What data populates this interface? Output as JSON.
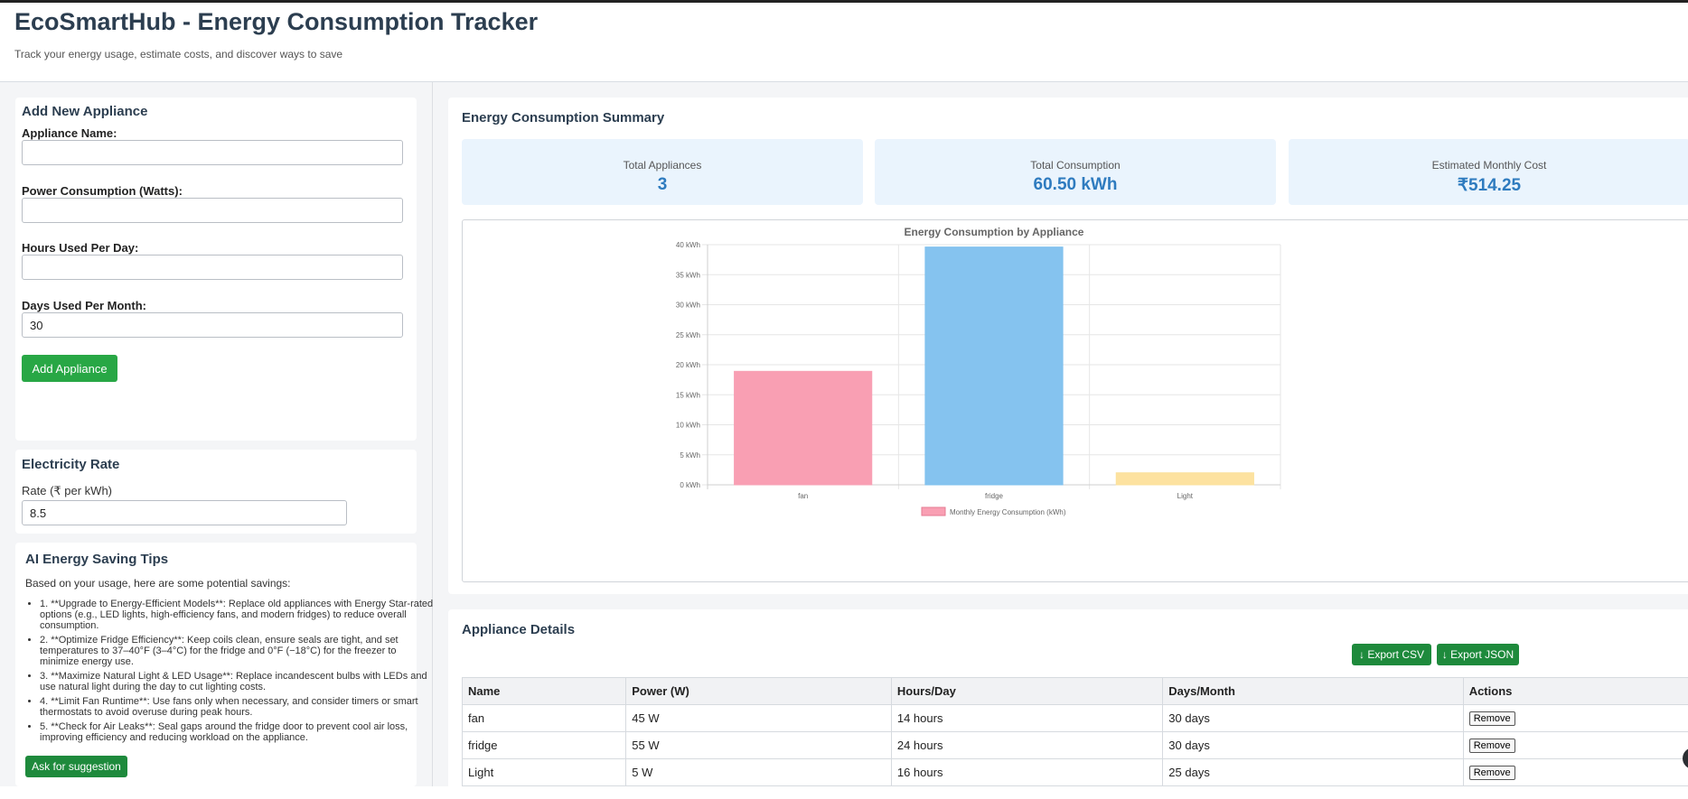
{
  "header": {
    "title": "EcoSmartHub - Energy Consumption Tracker",
    "subtitle": "Track your energy usage, estimate costs, and discover ways to save"
  },
  "add_appliance": {
    "heading": "Add New Appliance",
    "name_label": "Appliance Name:",
    "name_value": "",
    "power_label": "Power Consumption (Watts):",
    "power_value": "",
    "hours_label": "Hours Used Per Day:",
    "hours_value": "",
    "days_label": "Days Used Per Month:",
    "days_value": "30",
    "submit_label": "Add Appliance"
  },
  "electricity_rate": {
    "heading": "Electricity Rate",
    "rate_label": "Rate (₹ per kWh)",
    "rate_value": "8.5"
  },
  "tips": {
    "heading": "AI Energy Saving Tips",
    "intro": "Based on your usage, here are some potential savings:",
    "items": [
      "1. **Upgrade to Energy-Efficient Models**: Replace old appliances with Energy Star-rated options (e.g., LED lights, high-efficiency fans, and modern fridges) to reduce overall consumption.",
      "2. **Optimize Fridge Efficiency**: Keep coils clean, ensure seals are tight, and set temperatures to 37–40°F (3–4°C) for the fridge and 0°F (−18°C) for the freezer to minimize energy use.",
      "3. **Maximize Natural Light & LED Usage**: Replace incandescent bulbs with LEDs and use natural light during the day to cut lighting costs.",
      "4. **Limit Fan Runtime**: Use fans only when necessary, and consider timers or smart thermostats to avoid overuse during peak hours.",
      "5. **Check for Air Leaks**: Seal gaps around the fridge door to prevent cool air loss, improving efficiency and reducing workload on the appliance."
    ],
    "button_label": "Ask for suggestion"
  },
  "summary": {
    "heading": "Energy Consumption Summary",
    "stats": [
      {
        "label": "Total Appliances",
        "value": "3"
      },
      {
        "label": "Total Consumption",
        "value": "60.50 kWh"
      },
      {
        "label": "Estimated Monthly Cost",
        "value": "₹514.25"
      }
    ]
  },
  "chart_data": {
    "type": "bar",
    "title": "Energy Consumption by Appliance",
    "categories": [
      "fan",
      "fridge",
      "Light"
    ],
    "series": [
      {
        "name": "Monthly Energy Consumption (kWh)",
        "values": [
          18.9,
          39.6,
          2.0
        ]
      }
    ],
    "bar_colors": [
      "#f99fb3",
      "#85c3ef",
      "#fde2a0"
    ],
    "bar_borders": [
      "#f7a1b4",
      "#7fc0ee",
      "#fbe19c"
    ],
    "ylim": [
      0,
      40
    ],
    "yticks": [
      0,
      5,
      10,
      15,
      20,
      25,
      30,
      35,
      40
    ],
    "ytick_suffix": " kWh",
    "legend_position": "bottom",
    "grid": true
  },
  "details": {
    "heading": "Appliance Details",
    "export_csv_label": "↓ Export CSV",
    "export_json_label": "↓ Export JSON",
    "columns": [
      "Name",
      "Power (W)",
      "Hours/Day",
      "Days/Month",
      "Actions"
    ],
    "rows": [
      [
        "fan",
        "45 W",
        "14 hours",
        "30 days"
      ],
      [
        "fridge",
        "55 W",
        "24 hours",
        "30 days"
      ],
      [
        "Light",
        "5 W",
        "16 hours",
        "25 days"
      ]
    ],
    "remove_label": "Remove"
  }
}
